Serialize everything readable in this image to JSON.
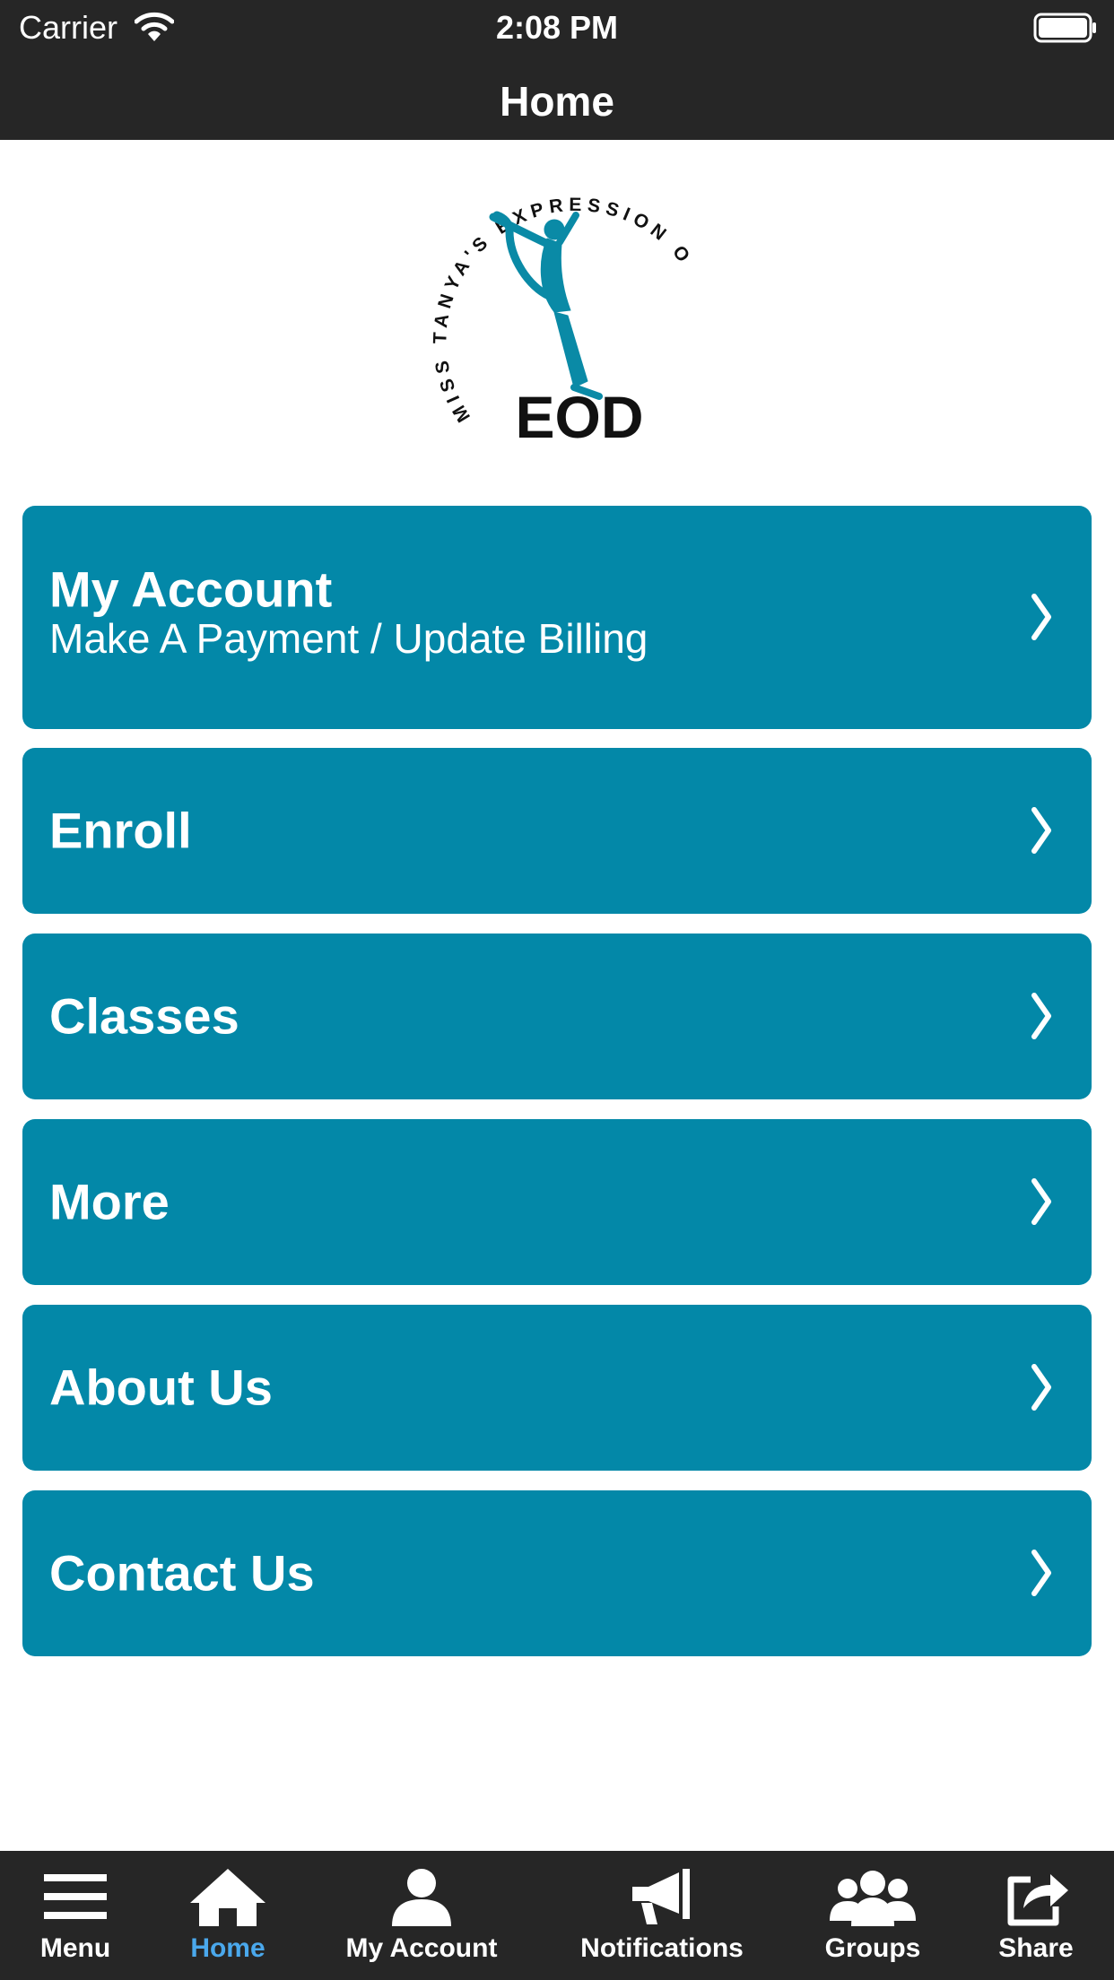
{
  "status_bar": {
    "carrier": "Carrier",
    "time": "2:08 PM"
  },
  "nav_bar": {
    "title": "Home"
  },
  "logo": {
    "arc_text": "MISS TANYA'S EXPRESSION OF DANCE",
    "initials": "EOD",
    "accent_color": "#0a8aa6"
  },
  "menu": [
    {
      "title": "My Account",
      "subtitle": "Make A Payment / Update Billing",
      "icon": "chevron-right-icon"
    },
    {
      "title": "Enroll",
      "icon": "chevron-right-icon"
    },
    {
      "title": "Classes",
      "icon": "chevron-right-icon"
    },
    {
      "title": "More",
      "icon": "chevron-right-icon"
    },
    {
      "title": "About Us",
      "icon": "chevron-right-icon"
    },
    {
      "title": "Contact Us",
      "icon": "chevron-right-icon"
    }
  ],
  "tab_bar": {
    "tabs": [
      {
        "label": "Menu",
        "icon": "hamburger-menu-icon"
      },
      {
        "label": "Home",
        "icon": "home-icon",
        "active": true
      },
      {
        "label": "My Account",
        "icon": "user-icon"
      },
      {
        "label": "Notifications",
        "icon": "megaphone-icon"
      },
      {
        "label": "Groups",
        "icon": "group-icon"
      },
      {
        "label": "Share",
        "icon": "share-icon"
      }
    ]
  },
  "colors": {
    "bar_background": "#262626",
    "card_background": "#0388a8",
    "active_tab": "#4aa8ec",
    "text": "#ffffff"
  }
}
